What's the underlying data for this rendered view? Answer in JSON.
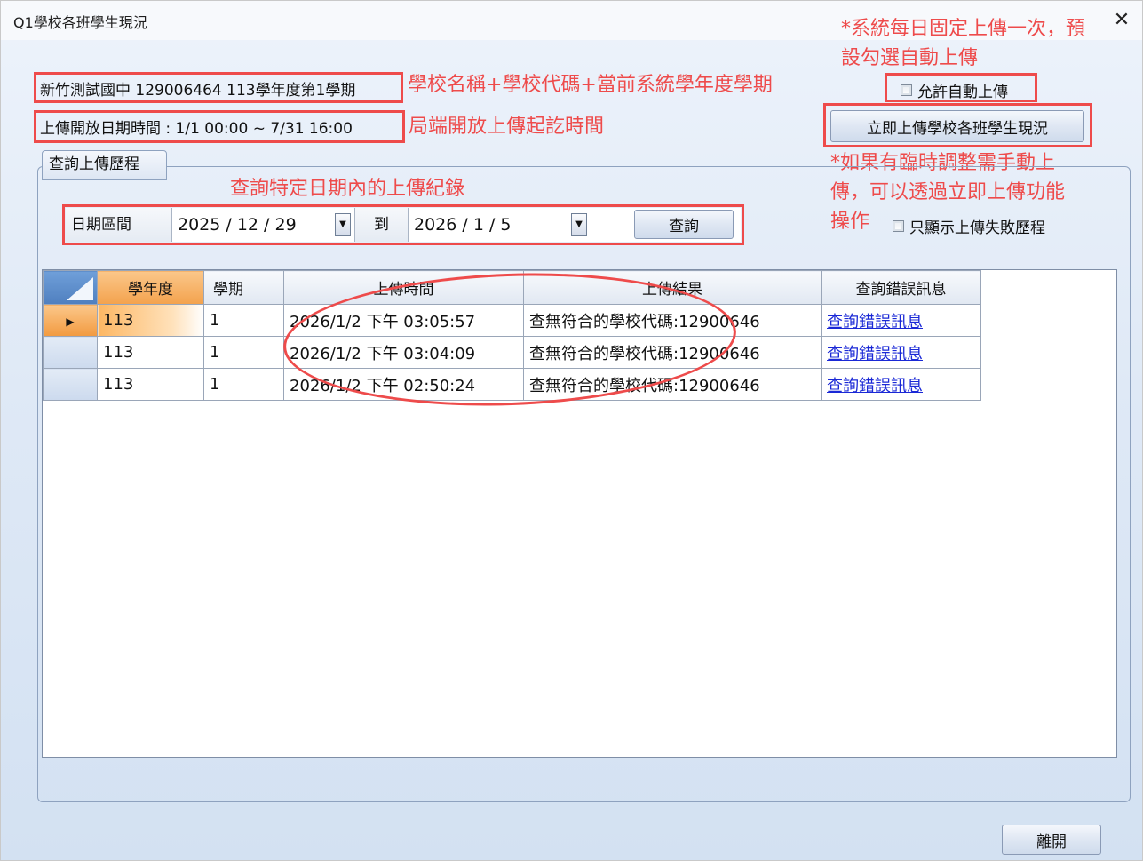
{
  "window": {
    "title": "Q1學校各班學生現況",
    "close_glyph": "✕"
  },
  "school_info": "新竹測試國中 129006464 113學年度第1學期",
  "upload_period": "上傳開放日期時間 : 1/1 00:00 ~ 7/31 16:00",
  "auto_upload": {
    "label": "允許自動上傳",
    "checked": false
  },
  "upload_now_button": "立即上傳學校各班學生現況",
  "history_group": {
    "title": "查詢上傳歷程",
    "date_range_label": "日期區間",
    "from_date": "2025 / 12 / 29",
    "to_label": "到",
    "to_date": "2026 / 1 / 5",
    "query_button": "查詢",
    "failed_only": {
      "label": "只顯示上傳失敗歷程",
      "checked": false
    }
  },
  "table": {
    "columns": [
      "學年度",
      "學期",
      "上傳時間",
      "上傳結果",
      "查詢錯誤訊息"
    ],
    "rows": [
      {
        "year": "113",
        "semester": "1",
        "time": "2026/1/2 下午 03:05:57",
        "result": "查無符合的學校代碼:12900646",
        "error_link": "查詢錯誤訊息"
      },
      {
        "year": "113",
        "semester": "1",
        "time": "2026/1/2 下午 03:04:09",
        "result": "查無符合的學校代碼:12900646",
        "error_link": "查詢錯誤訊息"
      },
      {
        "year": "113",
        "semester": "1",
        "time": "2026/1/2 下午 02:50:24",
        "result": "查無符合的學校代碼:12900646",
        "error_link": "查詢錯誤訊息"
      }
    ]
  },
  "leave_button": "離開",
  "annotations": {
    "school_info": "學校名稱+學校代碼+當前系統學年度學期",
    "upload_period": "局端開放上傳起訖時間",
    "query_range": "查詢特定日期內的上傳紀錄",
    "auto_upload_line1": "*系統每日固定上傳一次，預",
    "auto_upload_line2": "設勾選自動上傳",
    "manual_line1": "*如果有臨時調整需手動上",
    "manual_line2": "傳，可以透過立即上傳功能",
    "manual_line3": "操作"
  },
  "colors": {
    "annotation_red": "#ee4b4b",
    "link_blue": "#1a28d6",
    "selected_orange": "#f3a24d"
  }
}
